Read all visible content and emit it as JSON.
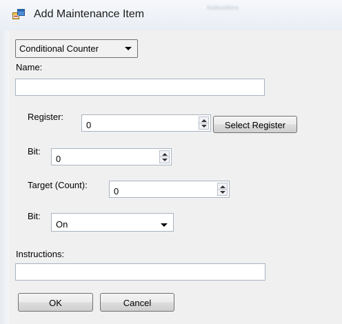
{
  "window": {
    "title": "Add Maintenance Item",
    "background_tab": "Instructions"
  },
  "form": {
    "type_combo": {
      "value": "Conditional Counter"
    },
    "name": {
      "label": "Name:",
      "value": ""
    },
    "register": {
      "label": "Register:",
      "value": "0",
      "select_button": "Select Register"
    },
    "bit": {
      "label": "Bit:",
      "value": "0"
    },
    "target": {
      "label": "Target (Count):",
      "value": "0"
    },
    "bit_state": {
      "label": "Bit:",
      "value": "On"
    },
    "instructions": {
      "label": "Instructions:",
      "value": ""
    }
  },
  "buttons": {
    "ok": "OK",
    "cancel": "Cancel"
  },
  "colors": {
    "client_bg": "#f0f0f0",
    "border": "#a9b3c0",
    "title_text": "#1b1b1b"
  },
  "icons": [
    "app-window-icon",
    "chevron-down-icon",
    "spin-up-icon",
    "spin-down-icon"
  ]
}
